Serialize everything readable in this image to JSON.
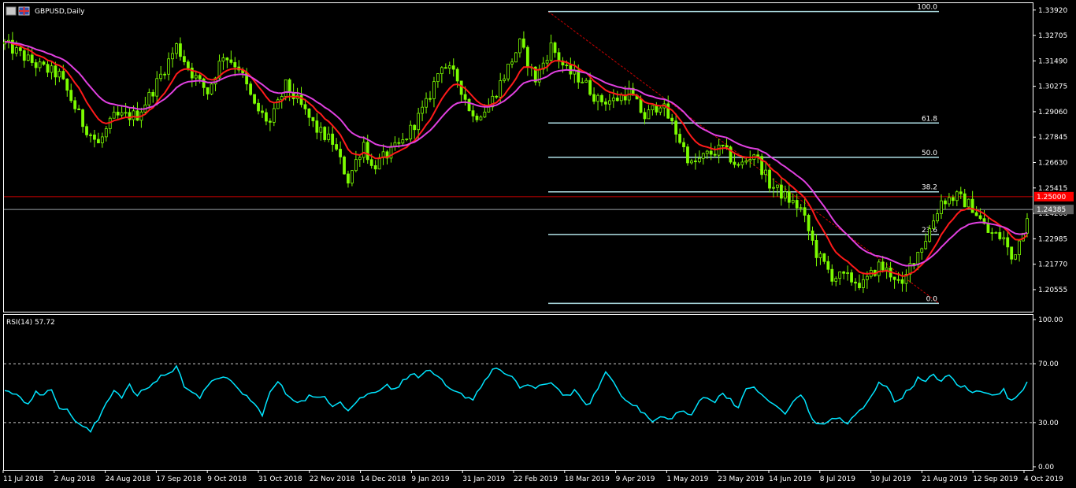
{
  "header": {
    "symbol_label": "GBPUSD,Daily"
  },
  "rsi": {
    "label": "RSI(14) 57.72",
    "levels": [
      "100.00",
      "70.00",
      "30.00",
      "0.00"
    ]
  },
  "colors": {
    "candle": "#7CFC00",
    "ma_fast": "#ff1a1a",
    "ma_slow": "#e040e0",
    "rsi": "#00e5ff",
    "fib": "#b0e0e6",
    "hline": "#cc0000",
    "price_tag": "#ff0000",
    "bid_tag": "#606060",
    "frame": "#ffffff"
  },
  "chart_data": [
    {
      "type": "candlestick",
      "title": "GBPUSD,Daily",
      "x_tick_labels": [
        "11 Jul 2018",
        "2 Aug 2018",
        "24 Aug 2018",
        "17 Sep 2018",
        "9 Oct 2018",
        "31 Oct 2018",
        "22 Nov 2018",
        "14 Dec 2018",
        "9 Jan 2019",
        "31 Jan 2019",
        "22 Feb 2019",
        "18 Mar 2019",
        "9 Apr 2019",
        "1 May 2019",
        "23 May 2019",
        "14 Jun 2019",
        "8 Jul 2019",
        "30 Jul 2019",
        "21 Aug 2019",
        "12 Sep 2019",
        "4 Oct 2019"
      ],
      "y_tick_labels": [
        "1.33920",
        "1.32705",
        "1.31490",
        "1.30275",
        "1.29060",
        "1.27845",
        "1.26630",
        "1.25415",
        "1.24200",
        "1.22985",
        "1.21770",
        "1.20555"
      ],
      "ylim": [
        1.195,
        1.3425
      ],
      "price_path": [
        [
          0,
          1.323
        ],
        [
          8,
          1.313
        ],
        [
          14,
          1.308
        ],
        [
          20,
          1.285
        ],
        [
          24,
          1.275
        ],
        [
          28,
          1.288
        ],
        [
          34,
          1.289
        ],
        [
          38,
          1.301
        ],
        [
          44,
          1.322
        ],
        [
          48,
          1.309
        ],
        [
          52,
          1.3
        ],
        [
          56,
          1.318
        ],
        [
          60,
          1.312
        ],
        [
          64,
          1.293
        ],
        [
          68,
          1.285
        ],
        [
          72,
          1.303
        ],
        [
          76,
          1.293
        ],
        [
          80,
          1.282
        ],
        [
          84,
          1.276
        ],
        [
          88,
          1.258
        ],
        [
          92,
          1.276
        ],
        [
          94,
          1.264
        ],
        [
          98,
          1.27
        ],
        [
          102,
          1.276
        ],
        [
          108,
          1.294
        ],
        [
          112,
          1.314
        ],
        [
          116,
          1.306
        ],
        [
          120,
          1.288
        ],
        [
          124,
          1.293
        ],
        [
          128,
          1.308
        ],
        [
          132,
          1.323
        ],
        [
          136,
          1.306
        ],
        [
          140,
          1.322
        ],
        [
          144,
          1.31
        ],
        [
          148,
          1.306
        ],
        [
          152,
          1.296
        ],
        [
          156,
          1.296
        ],
        [
          160,
          1.3
        ],
        [
          164,
          1.288
        ],
        [
          168,
          1.295
        ],
        [
          172,
          1.281
        ],
        [
          176,
          1.265
        ],
        [
          180,
          1.27
        ],
        [
          184,
          1.273
        ],
        [
          188,
          1.264
        ],
        [
          192,
          1.271
        ],
        [
          196,
          1.256
        ],
        [
          200,
          1.25
        ],
        [
          204,
          1.244
        ],
        [
          208,
          1.223
        ],
        [
          212,
          1.212
        ],
        [
          216,
          1.211
        ],
        [
          220,
          1.208
        ],
        [
          224,
          1.217
        ],
        [
          228,
          1.212
        ],
        [
          230,
          1.206
        ],
        [
          232,
          1.217
        ],
        [
          236,
          1.23
        ],
        [
          240,
          1.248
        ],
        [
          244,
          1.25
        ],
        [
          248,
          1.245
        ],
        [
          252,
          1.233
        ],
        [
          256,
          1.23
        ],
        [
          258,
          1.22
        ],
        [
          260,
          1.229
        ],
        [
          262,
          1.242
        ]
      ],
      "moving_averages": [
        "fast (red)",
        "slow (magenta)"
      ],
      "horizontal_line": 1.25,
      "price_tags": [
        "1.25000",
        "1.24385"
      ],
      "fibonacci": {
        "from_high": 1.3385,
        "to_low": 1.199,
        "levels": [
          {
            "ratio": 100.0,
            "label": "100.0",
            "price": 1.3385
          },
          {
            "ratio": 61.8,
            "label": "61.8",
            "price": 1.2852
          },
          {
            "ratio": 50.0,
            "label": "50.0",
            "price": 1.2688
          },
          {
            "ratio": 38.2,
            "label": "38.2",
            "price": 1.2523
          },
          {
            "ratio": 23.6,
            "label": "23.6",
            "price": 1.2319
          },
          {
            "ratio": 0.0,
            "label": "0.0",
            "price": 1.199
          }
        ]
      }
    },
    {
      "type": "line",
      "title": "RSI(14) 57.72",
      "ylim": [
        0,
        100
      ],
      "levels": [
        30,
        70
      ],
      "last_value": 57.72,
      "rsi_path": [
        [
          0,
          51
        ],
        [
          4,
          48
        ],
        [
          6,
          42
        ],
        [
          8,
          52
        ],
        [
          10,
          48
        ],
        [
          12,
          53
        ],
        [
          14,
          41
        ],
        [
          16,
          38
        ],
        [
          18,
          32
        ],
        [
          20,
          27
        ],
        [
          22,
          24
        ],
        [
          24,
          32
        ],
        [
          26,
          44
        ],
        [
          28,
          52
        ],
        [
          30,
          48
        ],
        [
          32,
          55
        ],
        [
          34,
          48
        ],
        [
          36,
          53
        ],
        [
          38,
          56
        ],
        [
          40,
          62
        ],
        [
          42,
          63
        ],
        [
          44,
          68
        ],
        [
          46,
          55
        ],
        [
          48,
          52
        ],
        [
          50,
          47
        ],
        [
          52,
          54
        ],
        [
          54,
          60
        ],
        [
          56,
          62
        ],
        [
          58,
          57
        ],
        [
          60,
          52
        ],
        [
          62,
          48
        ],
        [
          64,
          42
        ],
        [
          66,
          36
        ],
        [
          68,
          50
        ],
        [
          70,
          58
        ],
        [
          72,
          50
        ],
        [
          74,
          46
        ],
        [
          76,
          44
        ],
        [
          78,
          48
        ],
        [
          80,
          46
        ],
        [
          82,
          48
        ],
        [
          84,
          42
        ],
        [
          86,
          45
        ],
        [
          88,
          38
        ],
        [
          90,
          44
        ],
        [
          92,
          48
        ],
        [
          94,
          50
        ],
        [
          96,
          53
        ],
        [
          98,
          56
        ],
        [
          100,
          52
        ],
        [
          102,
          58
        ],
        [
          104,
          64
        ],
        [
          106,
          60
        ],
        [
          108,
          66
        ],
        [
          110,
          62
        ],
        [
          112,
          58
        ],
        [
          114,
          52
        ],
        [
          116,
          50
        ],
        [
          118,
          48
        ],
        [
          120,
          46
        ],
        [
          122,
          55
        ],
        [
          124,
          62
        ],
        [
          126,
          68
        ],
        [
          128,
          63
        ],
        [
          130,
          60
        ],
        [
          132,
          54
        ],
        [
          134,
          56
        ],
        [
          136,
          53
        ],
        [
          138,
          55
        ],
        [
          140,
          58
        ],
        [
          142,
          52
        ],
        [
          144,
          48
        ],
        [
          146,
          51
        ],
        [
          148,
          45
        ],
        [
          150,
          42
        ],
        [
          152,
          54
        ],
        [
          154,
          64
        ],
        [
          156,
          58
        ],
        [
          158,
          48
        ],
        [
          160,
          45
        ],
        [
          162,
          40
        ],
        [
          164,
          36
        ],
        [
          166,
          30
        ],
        [
          168,
          34
        ],
        [
          170,
          32
        ],
        [
          172,
          36
        ],
        [
          174,
          38
        ],
        [
          176,
          34
        ],
        [
          178,
          45
        ],
        [
          180,
          48
        ],
        [
          182,
          44
        ],
        [
          184,
          50
        ],
        [
          186,
          46
        ],
        [
          188,
          40
        ],
        [
          190,
          52
        ],
        [
          192,
          55
        ],
        [
          194,
          48
        ],
        [
          196,
          44
        ],
        [
          198,
          41
        ],
        [
          200,
          35
        ],
        [
          202,
          44
        ],
        [
          204,
          50
        ],
        [
          206,
          38
        ],
        [
          208,
          28
        ],
        [
          210,
          30
        ],
        [
          212,
          32
        ],
        [
          214,
          33
        ],
        [
          216,
          29
        ],
        [
          218,
          35
        ],
        [
          220,
          40
        ],
        [
          222,
          47
        ],
        [
          224,
          58
        ],
        [
          226,
          55
        ],
        [
          228,
          44
        ],
        [
          230,
          48
        ],
        [
          232,
          53
        ],
        [
          234,
          60
        ],
        [
          236,
          57
        ],
        [
          238,
          63
        ],
        [
          240,
          58
        ],
        [
          242,
          62
        ],
        [
          244,
          56
        ],
        [
          246,
          54
        ],
        [
          248,
          50
        ],
        [
          250,
          52
        ],
        [
          252,
          51
        ],
        [
          254,
          48
        ],
        [
          256,
          52
        ],
        [
          258,
          44
        ],
        [
          260,
          50
        ],
        [
          262,
          57.72
        ]
      ]
    }
  ]
}
